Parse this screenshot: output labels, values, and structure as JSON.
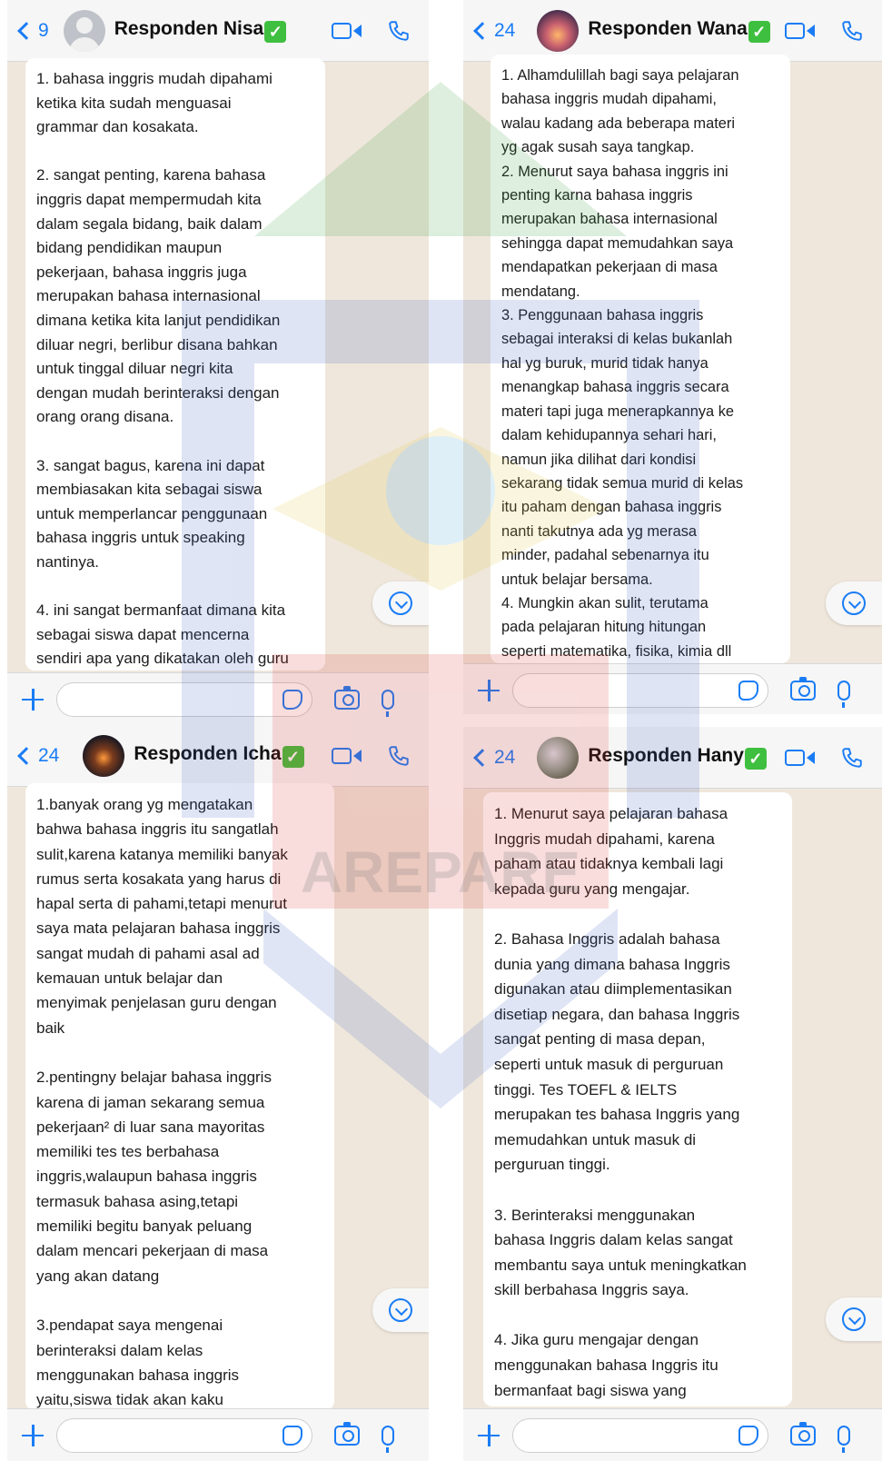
{
  "watermark": {
    "text": "AREPARE"
  },
  "icons": {
    "back": "chevron-left-icon",
    "video": "video-camera-icon",
    "phone": "phone-icon",
    "add": "plus-icon",
    "sticker": "sticker-icon",
    "camera": "camera-icon",
    "mic": "microphone-icon",
    "scroll": "scroll-down-icon",
    "verified": "check-mark-icon"
  },
  "colors": {
    "accent": "#1a7cf5",
    "chat_bg": "#efe7dc",
    "bubble": "#ffffff",
    "verified": "#3fbf3f"
  },
  "chats": [
    {
      "back_count": "9",
      "contact_name": "Responden Nisa",
      "verified": "✓",
      "message": "1. bahasa inggris mudah dipahami\nketika kita sudah menguasai\ngrammar dan kosakata.\n\n2. sangat penting, karena bahasa\ninggris dapat mempermudah kita\ndalam segala bidang, baik dalam\nbidang pendidikan maupun\npekerjaan, bahasa inggris juga\nmerupakan bahasa internasional\ndimana ketika kita lanjut pendidikan\ndiluar negri, berlibur disana bahkan\nuntuk tinggal diluar negri kita\ndengan mudah berinteraksi dengan\norang orang disana.\n\n3. sangat bagus, karena ini dapat\nmembiasakan kita sebagai siswa\nuntuk memperlancar penggunaan\nbahasa inggris untuk speaking\nnantinya.\n\n4. ini sangat bermanfaat dimana kita\nsebagai siswa dapat mencerna\nsendiri apa yang dikatakan oleh guru"
    },
    {
      "back_count": "24",
      "contact_name": "Responden Wana",
      "verified": "✓",
      "message": "1. Alhamdulillah bagi saya pelajaran\nbahasa inggris mudah dipahami,\nwalau kadang ada beberapa materi\nyg agak susah saya tangkap.\n2. Menurut saya bahasa inggris ini\npenting karna bahasa inggris\nmerupakan bahasa internasional\nsehingga dapat memudahkan saya\nmendapatkan pekerjaan di masa\nmendatang.\n3. Penggunaan bahasa inggris\nsebagai interaksi di kelas bukanlah\nhal yg buruk, murid tidak hanya\nmenangkap bahasa inggris secara\nmateri tapi juga menerapkannya ke\ndalam kehidupannya sehari hari,\nnamun jika dilihat dari kondisi\nsekarang tidak semua murid di kelas\nitu paham dengan bahasa inggris\nnanti takutnya ada yg merasa\nminder, padahal sebenarnya itu\nuntuk belajar bersama.\n4. Mungkin akan sulit, terutama\npada pelajaran hitung hitungan\nseperti matematika, fisika, kimia dll"
    },
    {
      "back_count": "24",
      "contact_name": "Responden Icha",
      "verified": "✓",
      "message": "1.banyak orang yg mengatakan\nbahwa bahasa inggris itu sangatlah\nsulit,karena katanya memiliki banyak\nrumus serta kosakata yang harus di\nhapal serta di pahami,tetapi menurut\nsaya mata pelajaran bahasa inggris\nsangat mudah di pahami asal ad\nkemauan untuk belajar dan\nmenyimak penjelasan guru dengan\nbaik\n\n2.pentingny belajar bahasa inggris\nkarena di jaman sekarang semua\npekerjaan² di luar sana mayoritas\nmemiliki tes tes berbahasa\ninggris,walaupun bahasa inggris\ntermasuk bahasa asing,tetapi\nmemiliki begitu banyak peluang\ndalam mencari pekerjaan di masa\nyang akan datang\n\n3.pendapat saya mengenai\nberinteraksi dalam kelas\nmenggunakan bahasa inggris\nyaitu,siswa tidak akan kaku"
    },
    {
      "back_count": "24",
      "contact_name": "Responden Hany",
      "verified": "✓",
      "message": "1. Menurut saya pelajaran bahasa\nInggris mudah dipahami, karena\npaham atau tidaknya kembali lagi\nkepada guru yang mengajar.\n\n2. Bahasa Inggris adalah bahasa\ndunia yang dimana bahasa Inggris\ndigunakan atau diimplementasikan\ndisetiap negara, dan bahasa Inggris\nsangat penting di masa depan,\nseperti untuk masuk di perguruan\ntinggi. Tes TOEFL & IELTS\nmerupakan tes bahasa Inggris yang\nmemudahkan untuk masuk di\nperguruan tinggi.\n\n3. Berinteraksi menggunakan\nbahasa Inggris dalam kelas sangat\nmembantu saya untuk meningkatkan\nskill berbahasa Inggris saya.\n\n4. Jika guru mengajar dengan\nmenggunakan bahasa Inggris itu\nbermanfaat bagi siswa yang\nmendengarkan, karena dengan guru"
    }
  ]
}
